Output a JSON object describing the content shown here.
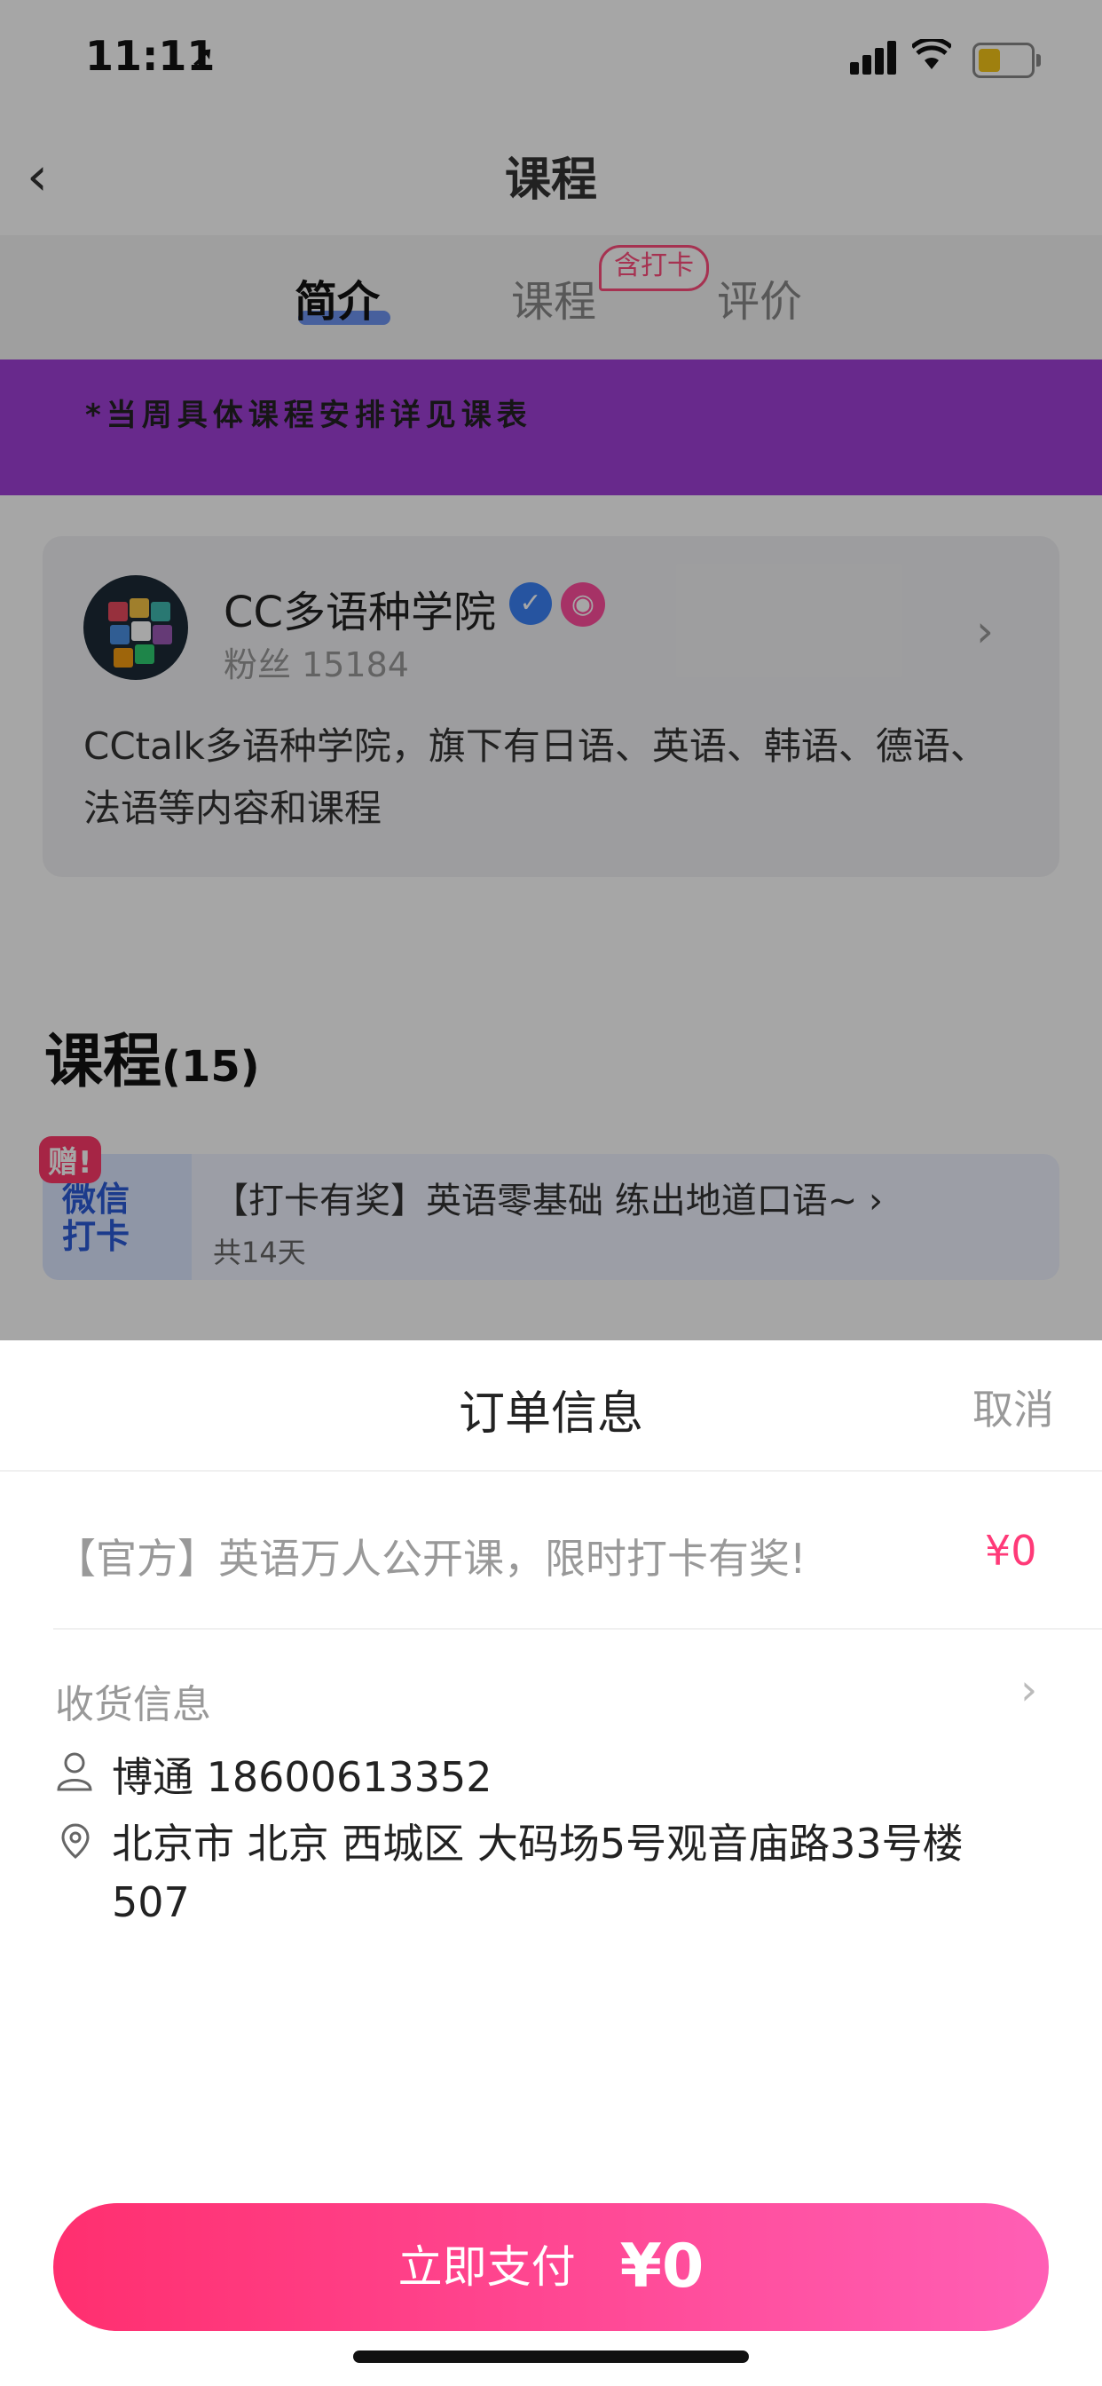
{
  "status_bar": {
    "time": "11:11",
    "location_glyph": "➚"
  },
  "nav": {
    "title": "课程",
    "back_glyph": "‹"
  },
  "tabs": [
    {
      "label": "简介",
      "active": true
    },
    {
      "label": "课程",
      "badge": "含打卡"
    },
    {
      "label": "评价"
    }
  ],
  "banner": {
    "text": "*当周具体课程安排详见课表"
  },
  "org": {
    "name": "CC多语种学院",
    "fans": "粉丝 15184",
    "description": "CCtalk多语种学院，旗下有日语、英语、韩语、德语、法语等内容和课程",
    "chevron_glyph": "›"
  },
  "courses": {
    "heading": "课程",
    "count": "(15)",
    "items": [
      {
        "gift_tag": "赠!",
        "thumb_text": "微信打卡",
        "title": "【打卡有奖】英语零基础 练出地道口语~ ›",
        "subtitle": "共14天"
      }
    ]
  },
  "order_sheet": {
    "title": "订单信息",
    "cancel_label": "取消",
    "product_name": "【官方】英语万人公开课，限时打卡有奖!",
    "product_price": "¥0",
    "address_label": "收货信息",
    "chevron_glyph": "›",
    "contact": "博通 18600613352",
    "address": "北京市 北京 西城区 大码场5号观音庙路33号楼507",
    "pay_label": "立即支付",
    "pay_amount": "¥0"
  },
  "colors": {
    "accent_pink": "#ff3a78",
    "banner_purple": "#a040d8",
    "tab_underline": "#4c7cf0",
    "verify_blue": "#3b82f6"
  },
  "icons": [
    "location-arrow-icon",
    "signal-icon",
    "wifi-icon",
    "battery-icon",
    "back-icon",
    "verified-icon",
    "badge-icon",
    "chevron-right-icon",
    "person-icon",
    "location-pin-icon"
  ]
}
